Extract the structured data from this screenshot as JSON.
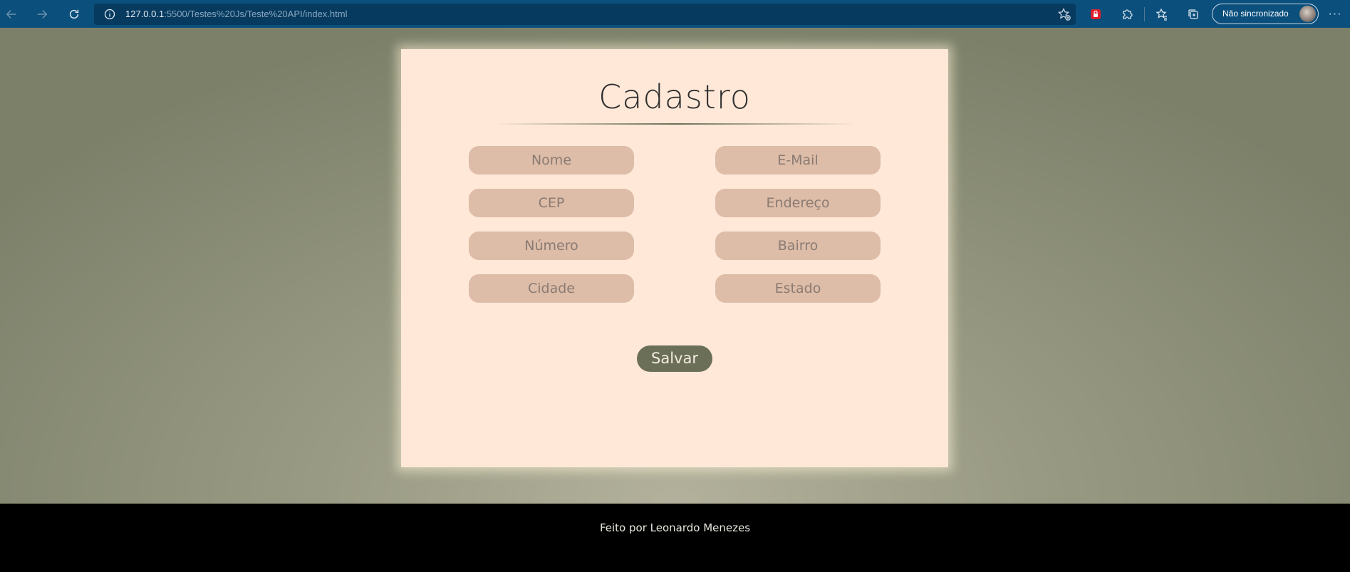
{
  "browser": {
    "url_host": "127.0.0.1",
    "url_rest": ":5500/Testes%20Js/Teste%20API/index.html",
    "profile_label": "Não sincronizado",
    "icons": [
      "back-arrow-icon",
      "forward-arrow-icon",
      "reload-icon",
      "info-icon",
      "add-favorite-icon",
      "extension-lock-icon",
      "puzzle-icon",
      "favorites-icon",
      "collections-icon",
      "more-icon"
    ]
  },
  "form": {
    "title": "Cadastro",
    "fields": {
      "nome": {
        "placeholder": "Nome"
      },
      "email": {
        "placeholder": "E-Mail"
      },
      "cep": {
        "placeholder": "CEP"
      },
      "endereco": {
        "placeholder": "Endereço"
      },
      "numero": {
        "placeholder": "Número"
      },
      "bairro": {
        "placeholder": "Bairro"
      },
      "cidade": {
        "placeholder": "Cidade"
      },
      "estado": {
        "placeholder": "Estado"
      }
    },
    "save_label": "Salvar"
  },
  "footer": {
    "text": "Feito por Leonardo Menezes"
  },
  "colors": {
    "card": "#ffe8d8",
    "field": "#ddbca8",
    "button": "#6b6f58",
    "browser_bar": "#0b4f7c"
  }
}
